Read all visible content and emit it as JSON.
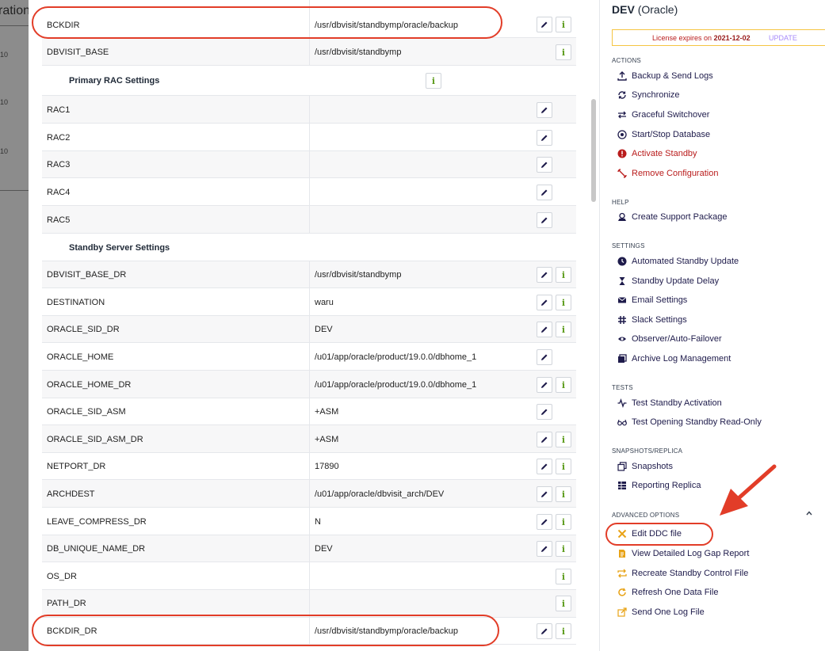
{
  "backdrop": {
    "fragment": "ration",
    "mini_labels": [
      "10",
      "10",
      "10"
    ]
  },
  "colors": {
    "accent": "#1e1b4b",
    "danger": "#b91c1c",
    "info": "#5b9b1a",
    "annotation": "#e23d28"
  },
  "rows": {
    "bckdir": {
      "key": "BCKDIR",
      "value": "/usr/dbvisit/standbymp/oracle/backup"
    },
    "dbvisit_base": {
      "key": "DBVISIT_BASE",
      "value": "/usr/dbvisit/standbymp"
    },
    "primary_rac_title": "Primary RAC Settings",
    "rac1": {
      "key": "RAC1",
      "value": ""
    },
    "rac2": {
      "key": "RAC2",
      "value": ""
    },
    "rac3": {
      "key": "RAC3",
      "value": ""
    },
    "rac4": {
      "key": "RAC4",
      "value": ""
    },
    "rac5": {
      "key": "RAC5",
      "value": ""
    },
    "standby_title": "Standby Server Settings",
    "dbvisit_base_dr": {
      "key": "DBVISIT_BASE_DR",
      "value": "/usr/dbvisit/standbymp"
    },
    "destination": {
      "key": "DESTINATION",
      "value": "waru"
    },
    "oracle_sid_dr": {
      "key": "ORACLE_SID_DR",
      "value": "DEV"
    },
    "oracle_home": {
      "key": "ORACLE_HOME",
      "value": "/u01/app/oracle/product/19.0.0/dbhome_1"
    },
    "oracle_home_dr": {
      "key": "ORACLE_HOME_DR",
      "value": "/u01/app/oracle/product/19.0.0/dbhome_1"
    },
    "oracle_sid_asm": {
      "key": "ORACLE_SID_ASM",
      "value": "+ASM"
    },
    "oracle_sid_asm_dr": {
      "key": "ORACLE_SID_ASM_DR",
      "value": "+ASM"
    },
    "netport_dr": {
      "key": "NETPORT_DR",
      "value": "17890"
    },
    "archdest": {
      "key": "ARCHDEST",
      "value": "/u01/app/oracle/dbvisit_arch/DEV"
    },
    "leave_compress_dr": {
      "key": "LEAVE_COMPRESS_DR",
      "value": "N"
    },
    "db_unique_name_dr": {
      "key": "DB_UNIQUE_NAME_DR",
      "value": "DEV"
    },
    "os_dr": {
      "key": "OS_DR",
      "value": ""
    },
    "path_dr": {
      "key": "PATH_DR",
      "value": ""
    },
    "bckdir_dr": {
      "key": "BCKDIR_DR",
      "value": "/usr/dbvisit/standbymp/oracle/backup"
    }
  },
  "sidebar": {
    "title": "DEV",
    "title_sub": "(Oracle)",
    "license": {
      "text": "License expires on",
      "date": "2021-12-02",
      "update": "UPDATE"
    },
    "actions_label": "ACTIONS",
    "actions": {
      "backup": "Backup & Send Logs",
      "synchronize": "Synchronize",
      "switchover": "Graceful Switchover",
      "startstop": "Start/Stop Database",
      "activate": "Activate Standby",
      "remove": "Remove Configuration"
    },
    "help_label": "HELP",
    "help": {
      "support": "Create Support Package"
    },
    "settings_label": "SETTINGS",
    "settings": {
      "auto_update": "Automated Standby Update",
      "delay": "Standby Update Delay",
      "email": "Email Settings",
      "slack": "Slack Settings",
      "observer": "Observer/Auto-Failover",
      "archive": "Archive Log Management"
    },
    "tests_label": "TESTS",
    "tests": {
      "activation": "Test Standby Activation",
      "readonly": "Test Opening Standby Read-Only"
    },
    "snapshots_label": "SNAPSHOTS/REPLICA",
    "snapshots": {
      "snapshots": "Snapshots",
      "replica": "Reporting Replica"
    },
    "advanced_label": "ADVANCED OPTIONS",
    "advanced": {
      "ddc": "Edit DDC file",
      "gap": "View Detailed Log Gap Report",
      "control": "Recreate Standby Control File",
      "refresh": "Refresh One Data File",
      "sendlog": "Send One Log File"
    }
  }
}
